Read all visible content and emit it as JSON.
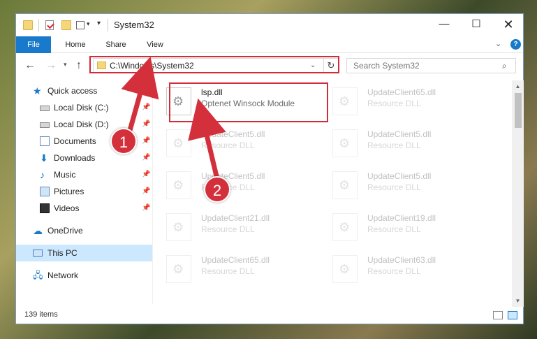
{
  "window": {
    "title": "System32",
    "controls": {
      "minimize": "—",
      "maximize": "☐",
      "close": "✕"
    }
  },
  "ribbon": {
    "tabs": [
      "File",
      "Home",
      "Share",
      "View"
    ],
    "expand_icon": "chevron-down-icon",
    "help_icon": "?"
  },
  "navigation": {
    "back": "←",
    "forward": "→",
    "recent": "▾",
    "up": "↑",
    "address": "C:\\Windows\\System32",
    "address_dropdown": "⌄",
    "refresh": "↻",
    "search_placeholder": "Search System32",
    "search_icon_glyph": "⌕"
  },
  "sidebar": {
    "items": [
      {
        "label": "Quick access",
        "icon": "star-icon",
        "glyph": "★",
        "pinned": false
      },
      {
        "label": "Local Disk (C:)",
        "icon": "drive-icon",
        "glyph": "",
        "pinned": true
      },
      {
        "label": "Local Disk (D:)",
        "icon": "drive-icon",
        "glyph": "",
        "pinned": true
      },
      {
        "label": "Documents",
        "icon": "documents-icon",
        "glyph": "",
        "pinned": true
      },
      {
        "label": "Downloads",
        "icon": "downloads-icon",
        "glyph": "⬇",
        "pinned": true
      },
      {
        "label": "Music",
        "icon": "music-icon",
        "glyph": "♪",
        "pinned": true
      },
      {
        "label": "Pictures",
        "icon": "pictures-icon",
        "glyph": "",
        "pinned": true
      },
      {
        "label": "Videos",
        "icon": "videos-icon",
        "glyph": "",
        "pinned": true
      },
      {
        "label": "OneDrive",
        "icon": "cloud-icon",
        "glyph": "☁",
        "pinned": false
      },
      {
        "label": "This PC",
        "icon": "computer-icon",
        "glyph": "",
        "pinned": false,
        "selected": true
      },
      {
        "label": "Network",
        "icon": "network-icon",
        "glyph": "🖧",
        "pinned": false
      }
    ],
    "pin_glyph": "📌"
  },
  "files": [
    {
      "name": "lsp.dll",
      "type": "Optenet Winsock Module",
      "highlighted": true
    },
    {
      "name": "UpdateClient65.dll",
      "type": "Resource DLL"
    },
    {
      "name": "UpdateClient5.dll",
      "type": "Resource DLL"
    },
    {
      "name": "UpdateClient5.dll",
      "type": "Resource DLL"
    },
    {
      "name": "UpdateClient5.dll",
      "type": "Resource DLL"
    },
    {
      "name": "UpdateClient5.dll",
      "type": "Resource DLL"
    },
    {
      "name": "UpdateClient21.dll",
      "type": "Resource DLL"
    },
    {
      "name": "UpdateClient19.dll",
      "type": "Resource DLL"
    },
    {
      "name": "UpdateClient65.dll",
      "type": "Resource DLL"
    },
    {
      "name": "UpdateClient63.dll",
      "type": "Resource DLL"
    }
  ],
  "status": {
    "item_count": "139 items"
  },
  "annotations": [
    {
      "label": "1"
    },
    {
      "label": "2"
    }
  ],
  "colors": {
    "accent": "#1979ca",
    "highlight": "#d22b3a",
    "selected_bg": "#cce8ff"
  }
}
